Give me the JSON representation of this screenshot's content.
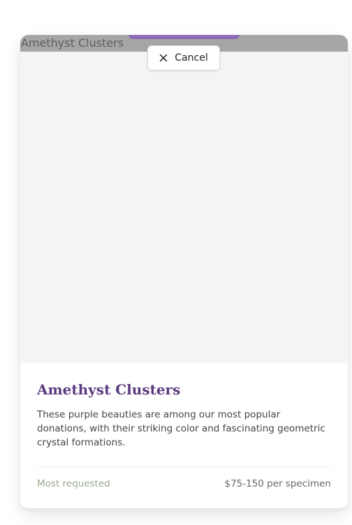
{
  "cancel_button": {
    "label": "Cancel",
    "icon": "close-icon"
  },
  "card": {
    "image_alt": "Amethyst Clusters",
    "title": "Amethyst Clusters",
    "description": "These purple beauties are among our most popular donations, with their striking color and fascinating geometric crystal formations.",
    "tag": "Most requested",
    "price": "$75-150 per specimen"
  },
  "colors": {
    "accent_purple": "#8f6ab8",
    "title_purple": "#5a3a7e",
    "tag_green": "#9aa88f"
  }
}
